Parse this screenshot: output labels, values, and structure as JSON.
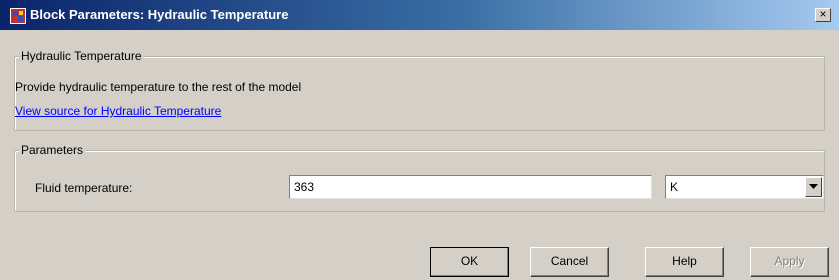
{
  "window": {
    "title": "Block Parameters: Hydraulic Temperature",
    "close_glyph": "×"
  },
  "description_group": {
    "label": "Hydraulic Temperature",
    "description": "Provide hydraulic temperature to the rest of the model",
    "link_text": "View source for Hydraulic Temperature"
  },
  "parameters_group": {
    "label": "Parameters",
    "field_label": "Fluid temperature:",
    "field_value": "363",
    "unit_value": "K"
  },
  "buttons": {
    "ok": "OK",
    "cancel": "Cancel",
    "help": "Help",
    "apply": "Apply"
  },
  "colors": {
    "dialog_background": "#d4d0c8",
    "titlebar_start": "#0a246a",
    "titlebar_end": "#a6caf0",
    "link": "#0000ff",
    "disabled_text": "#808080"
  },
  "icons": {
    "app": "simulink-block-icon",
    "close": "close-icon",
    "dropdown": "chevron-down-icon"
  }
}
